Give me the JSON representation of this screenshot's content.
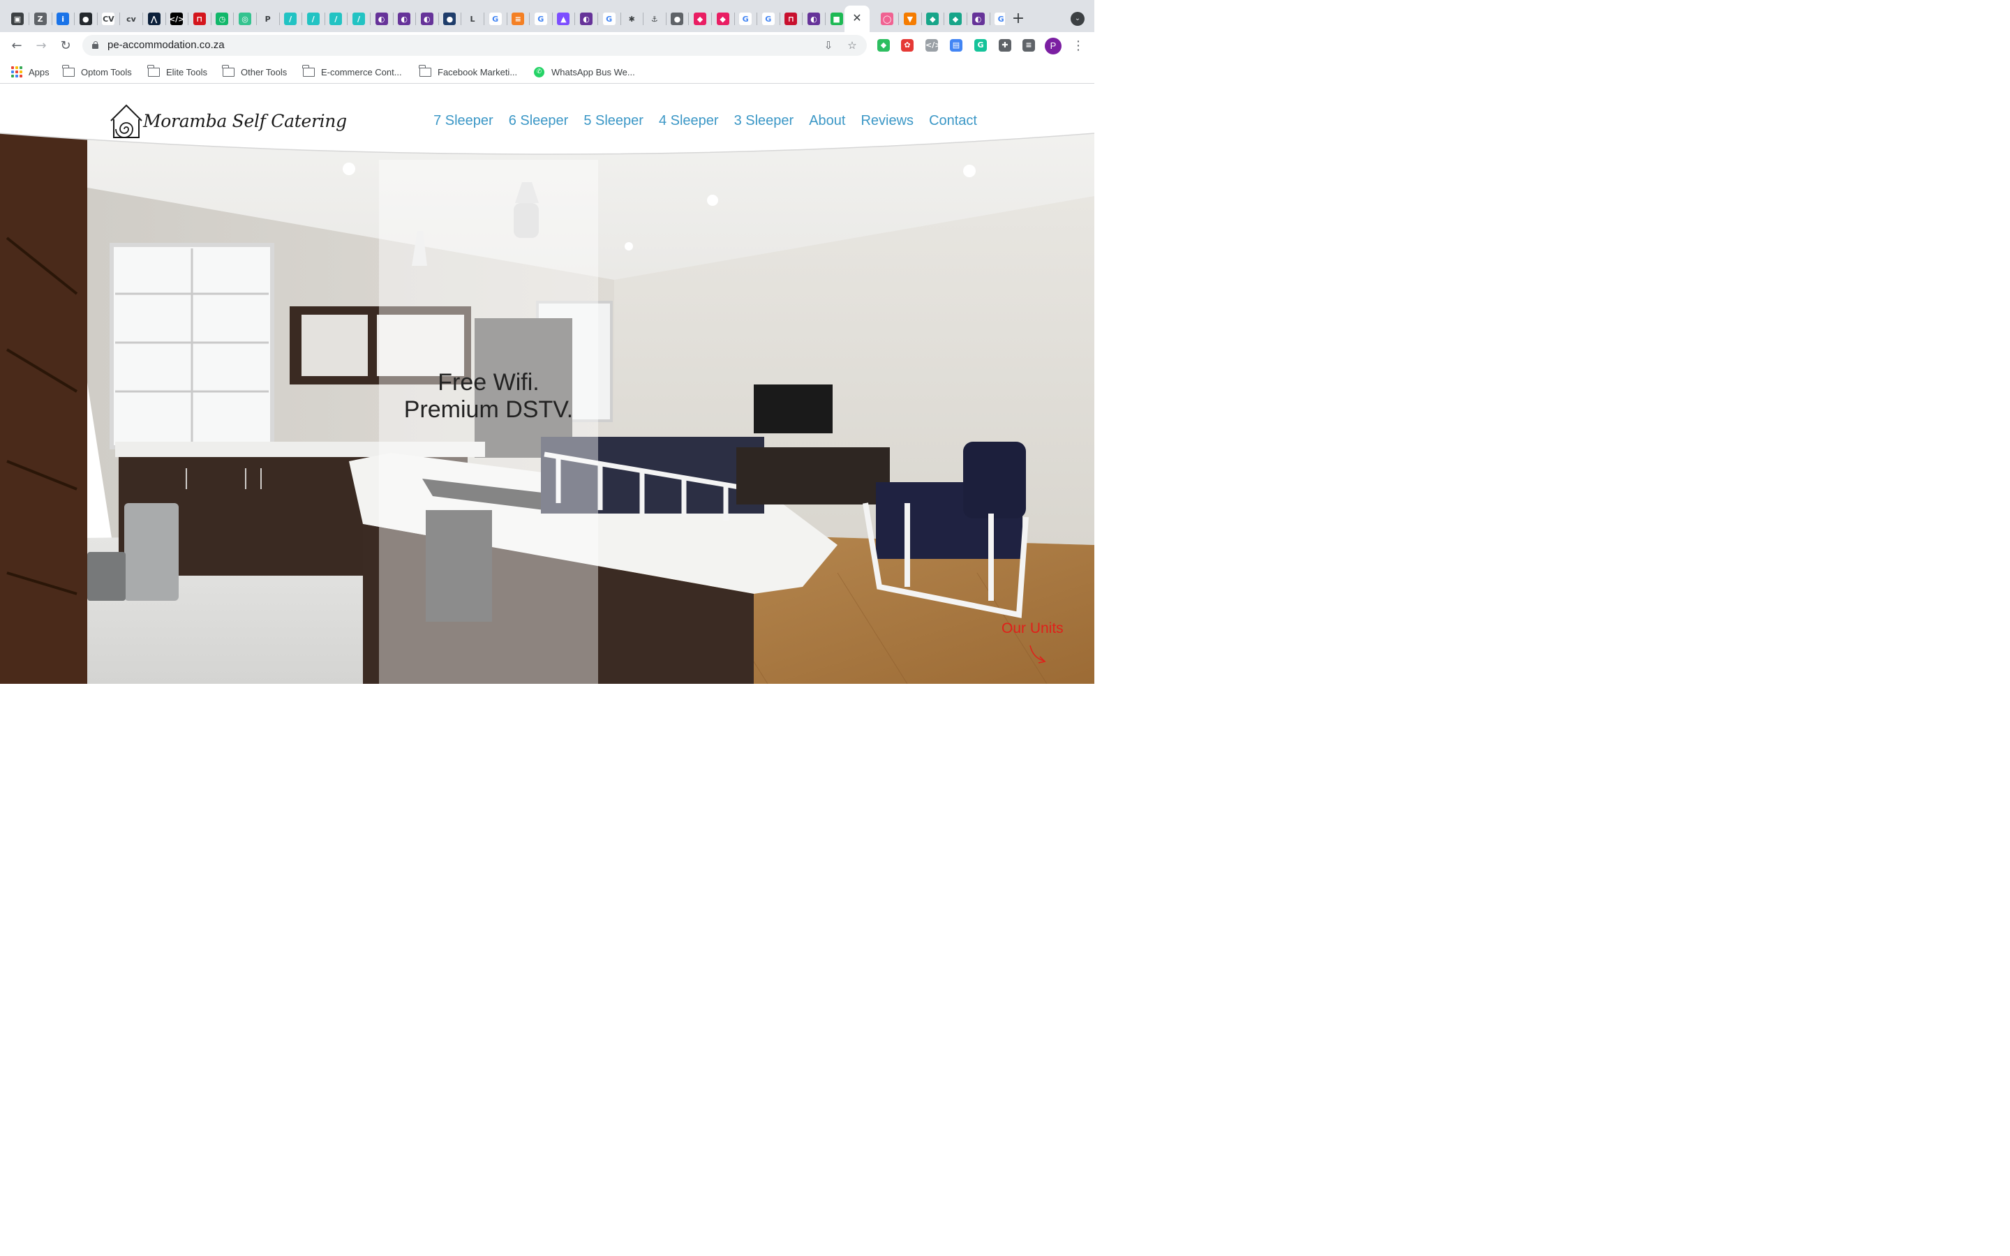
{
  "browser": {
    "active_tab": {
      "close_glyph": "✕"
    },
    "new_tab_glyph": "+",
    "tab_search_glyph": "⌄",
    "tabs": [
      {
        "icon": "wix-icon",
        "glyph": "▣",
        "bg": "#3c4043"
      },
      {
        "icon": "zotero-icon",
        "glyph": "Z",
        "bg": "#5f6368"
      },
      {
        "icon": "info-icon",
        "glyph": "i",
        "bg": "#1a73e8"
      },
      {
        "icon": "github-icon",
        "glyph": "●",
        "bg": "#24292e"
      },
      {
        "icon": "cv-icon",
        "glyph": "CV",
        "bg": "#ffffff"
      },
      {
        "icon": "cv-yellow-icon",
        "glyph": "cv",
        "bg": "#dee1e6"
      },
      {
        "icon": "angle-brackets-icon",
        "glyph": "⋀",
        "bg": "#0b1f3a"
      },
      {
        "icon": "code-icon",
        "glyph": "</>",
        "bg": "#000000"
      },
      {
        "icon": "red-square-icon",
        "glyph": "⊓",
        "bg": "#d4151c"
      },
      {
        "icon": "clock-icon",
        "glyph": "◷",
        "bg": "#12b76a"
      },
      {
        "icon": "spiral-icon",
        "glyph": "◎",
        "bg": "#34c38f"
      },
      {
        "icon": "p-logo-icon",
        "glyph": "P",
        "bg": "#dee1e6"
      },
      {
        "icon": "slash-teal-icon",
        "glyph": "/",
        "bg": "#22c3c3"
      },
      {
        "icon": "slash-teal-icon",
        "glyph": "/",
        "bg": "#22c3c3"
      },
      {
        "icon": "slash-teal-icon",
        "glyph": "/",
        "bg": "#22c3c3"
      },
      {
        "icon": "slash-teal-icon",
        "glyph": "/",
        "bg": "#22c3c3"
      },
      {
        "icon": "gatsby-icon",
        "glyph": "◐",
        "bg": "#663399"
      },
      {
        "icon": "gatsby-icon",
        "glyph": "◐",
        "bg": "#663399"
      },
      {
        "icon": "gatsby-icon",
        "glyph": "◐",
        "bg": "#663399"
      },
      {
        "icon": "dark-circle-icon",
        "glyph": "●",
        "bg": "#1f3d6b"
      },
      {
        "icon": "l-letter-icon",
        "glyph": "L",
        "bg": "#dee1e6"
      },
      {
        "icon": "google-icon",
        "glyph": "G",
        "bg": "#ffffff"
      },
      {
        "icon": "stackoverflow-icon",
        "glyph": "≡",
        "bg": "#f48024"
      },
      {
        "icon": "google-icon",
        "glyph": "G",
        "bg": "#ffffff"
      },
      {
        "icon": "rocket-icon",
        "glyph": "▲",
        "bg": "#7c4dff"
      },
      {
        "icon": "gatsby-icon",
        "glyph": "◐",
        "bg": "#663399"
      },
      {
        "icon": "google-icon",
        "glyph": "G",
        "bg": "#ffffff"
      },
      {
        "icon": "asterisk-icon",
        "glyph": "✱",
        "bg": "#dee1e6"
      },
      {
        "icon": "anchor-icon",
        "glyph": "⚓",
        "bg": "#dee1e6"
      },
      {
        "icon": "globe-icon",
        "glyph": "●",
        "bg": "#5f6368"
      },
      {
        "icon": "pink-icon",
        "glyph": "◆",
        "bg": "#e91e63"
      },
      {
        "icon": "pink-icon",
        "glyph": "◆",
        "bg": "#e91e63"
      },
      {
        "icon": "google-icon",
        "glyph": "G",
        "bg": "#ffffff"
      },
      {
        "icon": "google-icon",
        "glyph": "G",
        "bg": "#ffffff"
      },
      {
        "icon": "red-square-icon",
        "glyph": "⊓",
        "bg": "#c8102e"
      },
      {
        "icon": "gatsby-icon",
        "glyph": "◐",
        "bg": "#663399"
      },
      {
        "icon": "chat-icon",
        "glyph": "■",
        "bg": "#1db954"
      },
      {
        "icon": "pink-outline-icon",
        "glyph": "◯",
        "bg": "#f06292"
      },
      {
        "icon": "pizza-icon",
        "glyph": "▼",
        "bg": "#f57c00"
      },
      {
        "icon": "diamond-icon",
        "glyph": "◆",
        "bg": "#17a589"
      },
      {
        "icon": "diamond-icon",
        "glyph": "◆",
        "bg": "#17a589"
      },
      {
        "icon": "gatsby-icon",
        "glyph": "◐",
        "bg": "#663399"
      },
      {
        "icon": "google-icon",
        "glyph": "G",
        "bg": "#ffffff"
      }
    ],
    "toolbar": {
      "back_glyph": "←",
      "forward_glyph": "→",
      "reload_glyph": "↻",
      "url": "pe-accommodation.co.za",
      "install_glyph": "⇩",
      "bookmark_glyph": "☆",
      "extensions": [
        {
          "icon": "evernote-icon",
          "glyph": "◆",
          "bg": "#2dbe60"
        },
        {
          "icon": "color-wheel-icon",
          "glyph": "✿",
          "bg": "#e53935"
        },
        {
          "icon": "code-ext-icon",
          "glyph": "</>",
          "bg": "#9aa0a6"
        },
        {
          "icon": "reader-icon",
          "glyph": "▤",
          "bg": "#4285f4"
        },
        {
          "icon": "grammarly-icon",
          "glyph": "G",
          "bg": "#15c39a"
        },
        {
          "icon": "puzzle-icon",
          "glyph": "✚",
          "bg": "#5f6368"
        },
        {
          "icon": "playlist-icon",
          "glyph": "≡",
          "bg": "#5f6368"
        }
      ],
      "profile_initial": "P",
      "menu_glyph": "⋮"
    },
    "bookmarks": [
      {
        "label": "Apps",
        "type": "apps"
      },
      {
        "label": "Optom Tools",
        "type": "folder"
      },
      {
        "label": "Elite Tools",
        "type": "folder"
      },
      {
        "label": "Other Tools",
        "type": "folder"
      },
      {
        "label": "E-commerce Cont...",
        "type": "folder"
      },
      {
        "label": "Facebook Marketi...",
        "type": "folder"
      },
      {
        "label": "WhatsApp Bus We...",
        "type": "whatsapp"
      }
    ]
  },
  "site": {
    "logo_text": "Moramba Self Catering",
    "nav": [
      "7 Sleeper",
      "6 Sleeper",
      "5 Sleeper",
      "4 Sleeper",
      "3 Sleeper",
      "About",
      "Reviews",
      "Contact"
    ],
    "hero_line1": "Free Wifi.",
    "hero_line2": "Premium DSTV.",
    "our_units": "Our Units",
    "colors": {
      "nav_link": "#3b97c6",
      "our_units": "#e0201a",
      "hero_text": "#222222"
    }
  }
}
